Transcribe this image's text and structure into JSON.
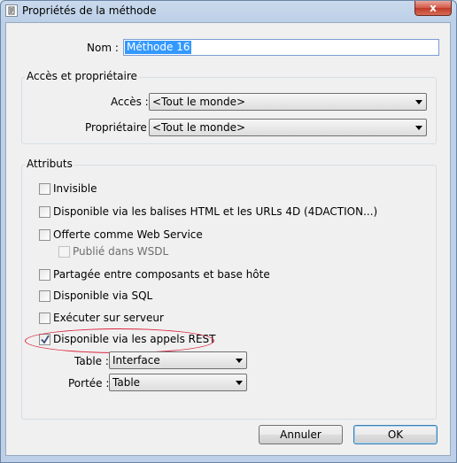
{
  "window": {
    "title": "Propriétés de la méthode",
    "close_label": "x"
  },
  "name": {
    "label": "Nom :",
    "value": "Méthode 16"
  },
  "access_group": {
    "title": "Accès et propriétaire",
    "access_label": "Accès :",
    "access_value": "<Tout le monde>",
    "owner_label": "Propriétaire :",
    "owner_value": "<Tout le monde>"
  },
  "attributes": {
    "title": "Attributs",
    "invisible": {
      "label": "Invisible",
      "checked": false
    },
    "html_4daction": {
      "label": "Disponible via les balises HTML et les URLs 4D (4DACTION...)",
      "checked": false
    },
    "web_service": {
      "label": "Offerte comme Web Service",
      "checked": false
    },
    "wsdl": {
      "label": "Publié dans WSDL",
      "checked": false,
      "enabled": false
    },
    "shared": {
      "label": "Partagée entre composants et base hôte",
      "checked": false
    },
    "sql": {
      "label": "Disponible via SQL",
      "checked": false
    },
    "server": {
      "label": "Exécuter sur serveur",
      "checked": false
    },
    "rest": {
      "label": "Disponible via les appels REST",
      "checked": true
    },
    "table_label": "Table :",
    "table_value": "Interface",
    "scope_label": "Portée :",
    "scope_value": "Table"
  },
  "buttons": {
    "cancel": "Annuler",
    "ok": "OK"
  },
  "colors": {
    "highlight_ellipse": "#d9263d",
    "selection": "#3399ff"
  }
}
